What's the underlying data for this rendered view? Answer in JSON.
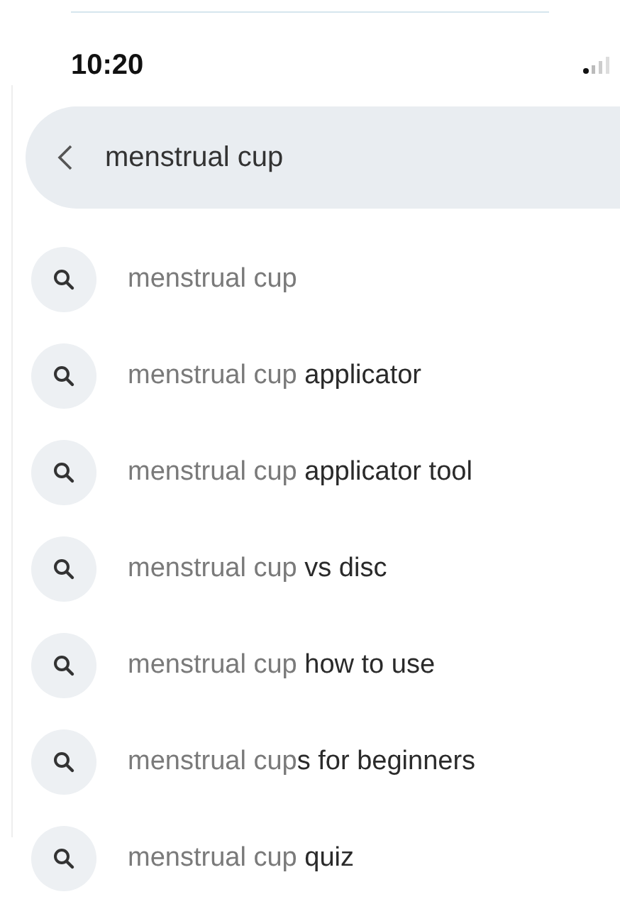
{
  "status_bar": {
    "time": "10:20"
  },
  "search": {
    "value": "menstrual cup"
  },
  "suggestions": [
    {
      "text": "menstrual cup"
    },
    {
      "text": "menstrual cup **applicator**"
    },
    {
      "text": "menstrual cup **applicator tool**"
    },
    {
      "text": "menstrual cup **vs disc**"
    },
    {
      "text": "menstrual cup **how to use**"
    },
    {
      "text": "menstrual cup**s for beginners**"
    },
    {
      "text": "menstrual cup **quiz**"
    }
  ]
}
